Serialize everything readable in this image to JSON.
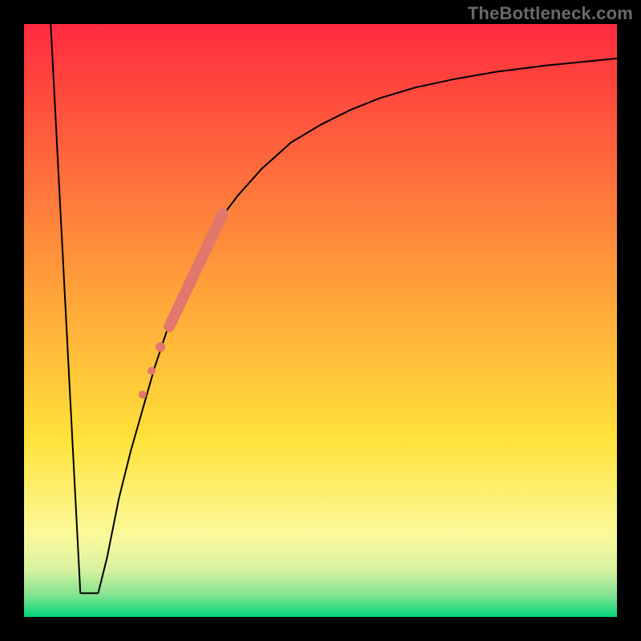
{
  "watermark": "TheBottleneck.com",
  "chart_data": {
    "type": "line",
    "title": "",
    "xlabel": "",
    "ylabel": "",
    "xlim": [
      0,
      100
    ],
    "ylim": [
      0,
      100
    ],
    "grid": false,
    "legend": false,
    "background_gradient": {
      "stops": [
        {
          "offset": 0.0,
          "color": "#ff2b3f"
        },
        {
          "offset": 0.45,
          "color": "#ffa23a"
        },
        {
          "offset": 0.7,
          "color": "#ffe23a"
        },
        {
          "offset": 0.86,
          "color": "#fbf99a"
        },
        {
          "offset": 0.92,
          "color": "#d9f2a0"
        },
        {
          "offset": 0.965,
          "color": "#7ee28f"
        },
        {
          "offset": 1.0,
          "color": "#00d67a"
        }
      ]
    },
    "series": [
      {
        "name": "left-descent",
        "stroke": "#000000",
        "stroke_width": 2,
        "x": [
          4.5,
          9.5
        ],
        "y": [
          100,
          4
        ]
      },
      {
        "name": "valley-floor",
        "stroke": "#000000",
        "stroke_width": 2,
        "x": [
          9.5,
          12.5
        ],
        "y": [
          4,
          4
        ]
      },
      {
        "name": "right-curve",
        "stroke": "#000000",
        "stroke_width": 2,
        "x": [
          12.5,
          14,
          16,
          18,
          20,
          22,
          24,
          26,
          28,
          30,
          33,
          36,
          40,
          45,
          50,
          55,
          60,
          66,
          73,
          80,
          88,
          95,
          100
        ],
        "y": [
          4,
          10,
          20,
          28,
          35,
          42,
          48,
          53,
          58,
          62,
          67,
          71,
          75.5,
          80,
          83,
          85.5,
          87.5,
          89.3,
          90.8,
          92,
          93,
          93.7,
          94.2
        ]
      }
    ],
    "overlay_segments": [
      {
        "name": "thick-coral-segment",
        "stroke": "#e2776b",
        "stroke_width": 14,
        "linecap": "round",
        "x": [
          24.5,
          33.5
        ],
        "y": [
          49,
          68
        ]
      }
    ],
    "overlay_points": [
      {
        "name": "coral-dot-upper",
        "x": 23.0,
        "y": 45.5,
        "r": 6,
        "fill": "#e2776b"
      },
      {
        "name": "coral-dot-mid",
        "x": 21.5,
        "y": 41.5,
        "r": 5,
        "fill": "#e2776b"
      },
      {
        "name": "coral-dot-lower",
        "x": 20.0,
        "y": 37.5,
        "r": 5,
        "fill": "#e2776b"
      }
    ]
  }
}
